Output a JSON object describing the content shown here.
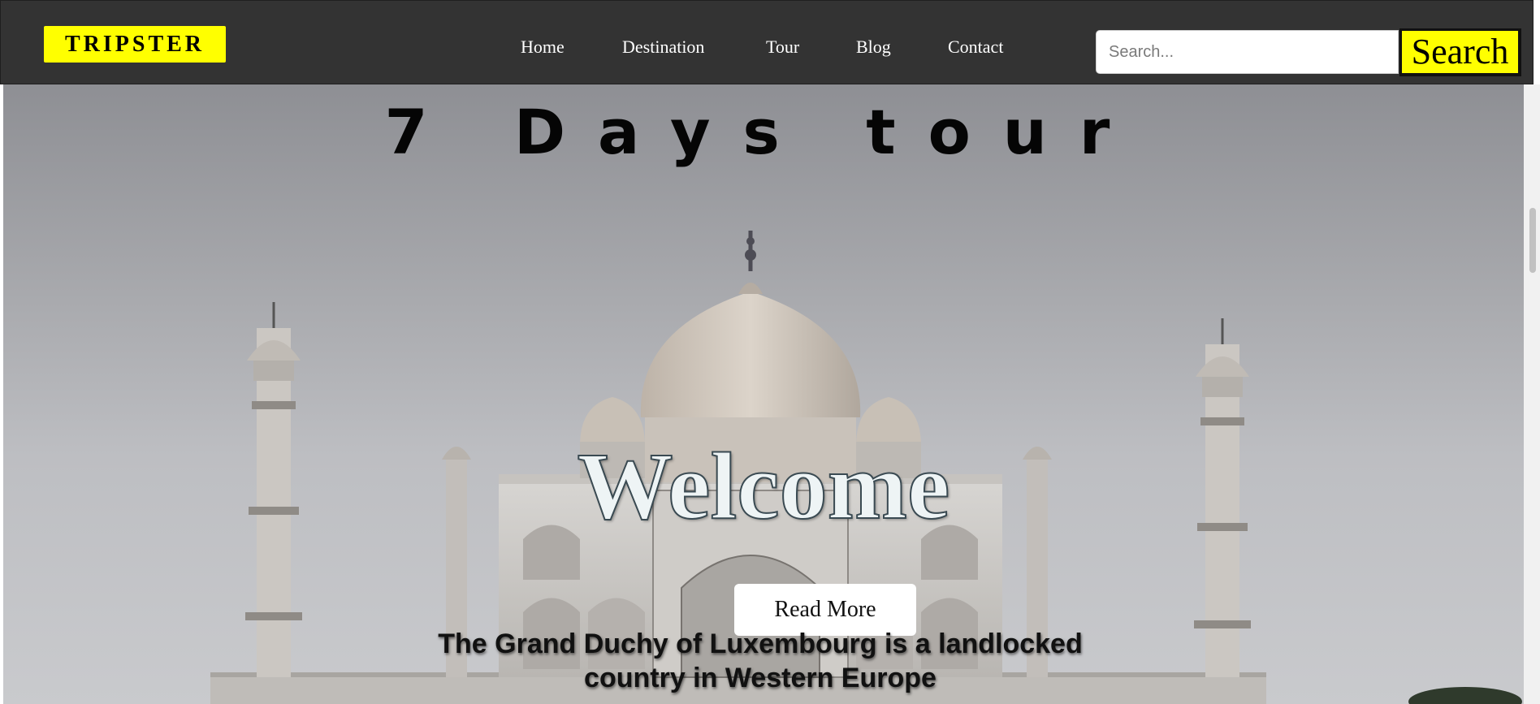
{
  "header": {
    "logo": "TRIPSTER",
    "nav": [
      {
        "label": "Home"
      },
      {
        "label": "Destination"
      },
      {
        "label": "Tour"
      },
      {
        "label": "Blog"
      },
      {
        "label": "Contact"
      }
    ],
    "search": {
      "placeholder": "Search...",
      "value": "",
      "button_label": "Search"
    }
  },
  "hero": {
    "title": "7 Days tour",
    "welcome": "Welcome",
    "read_more": "Read More",
    "tagline": "The Grand Duchy of Luxembourg is a landlocked country in Western Europe"
  },
  "colors": {
    "header_bg": "#333333",
    "accent": "#ffff00",
    "text_light": "#ffffff"
  },
  "icons": [
    "taj-mahal-image"
  ]
}
